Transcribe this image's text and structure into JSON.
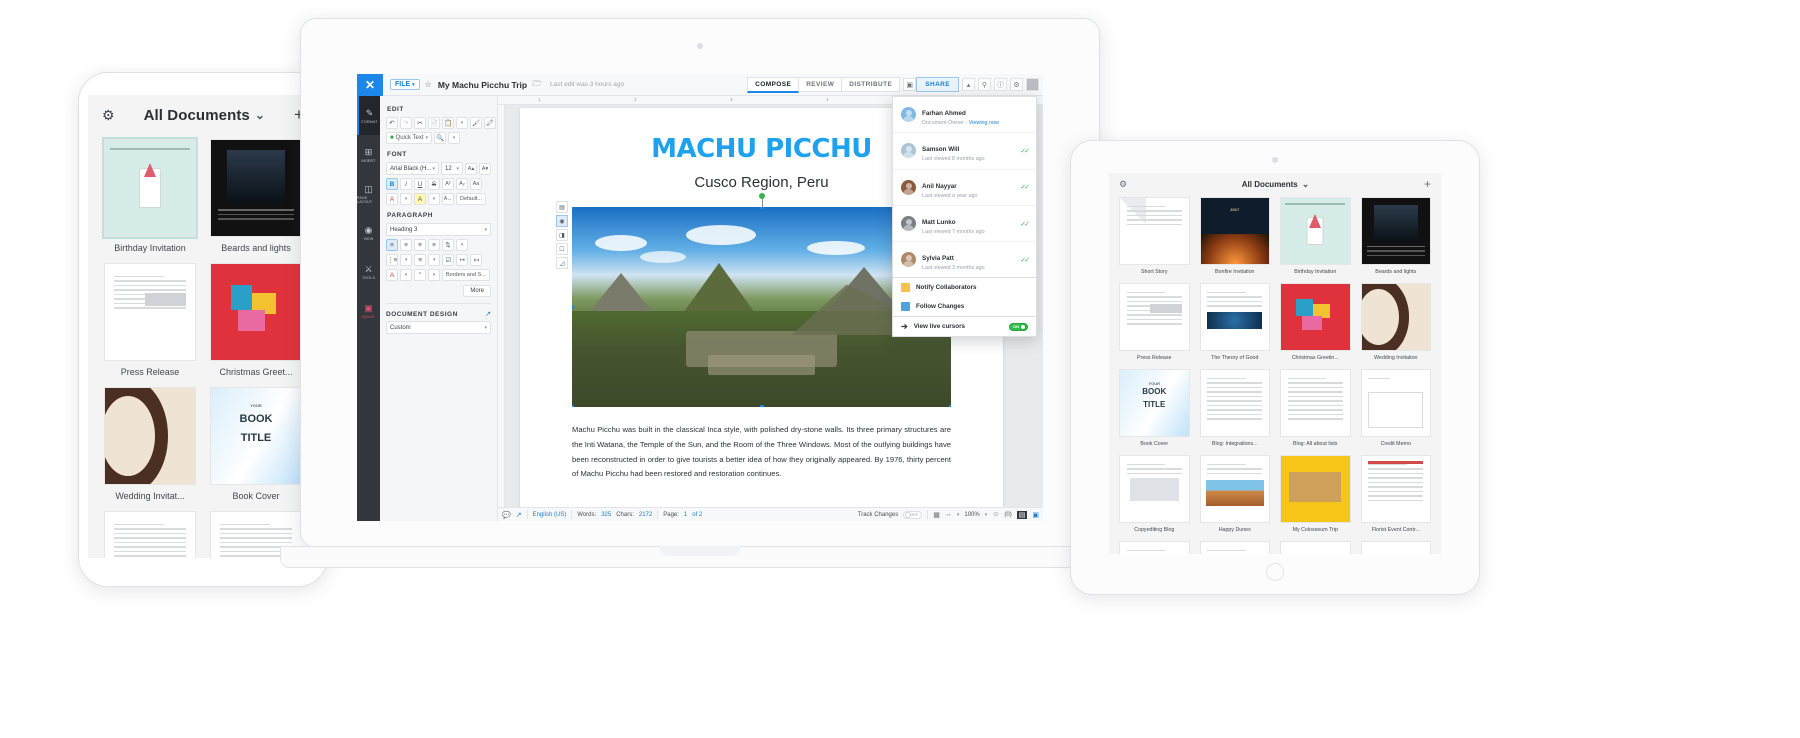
{
  "phone": {
    "header": {
      "title": "All Documents",
      "gear_icon": "gear-icon",
      "add_icon": "plus-icon",
      "chevron": "⌄"
    },
    "selected_actions": [
      "share-icon",
      "trash-icon",
      "info-icon"
    ],
    "documents": [
      {
        "label": "Birthday Invitation",
        "style": "birthday",
        "selected": true
      },
      {
        "label": "Beards and lights",
        "style": "beards"
      },
      {
        "label": "Press Release",
        "style": "press"
      },
      {
        "label": "Christmas Greet...",
        "style": "christmas"
      },
      {
        "label": "Wedding Invitat...",
        "style": "wedding"
      },
      {
        "label": "Book Cover",
        "style": "bookcover"
      },
      {
        "label": "",
        "style": "plain"
      },
      {
        "label": "",
        "style": "plain"
      }
    ]
  },
  "laptop": {
    "titlebar": {
      "close_label": "✕",
      "file_menu": "FILE",
      "star_icon": "star-icon",
      "doc_name": "My Machu Picchu Trip",
      "folder_icon": "folder-icon",
      "last_edit": "Last edit was 3 hours ago"
    },
    "tabs": [
      {
        "label": "COMPOSE",
        "active": true
      },
      {
        "label": "REVIEW",
        "active": false
      },
      {
        "label": "DISTRIBUTE",
        "active": false
      }
    ],
    "share_button": "SHARE",
    "top_icons": [
      "present-icon",
      "chevron-up-icon",
      "search-icon",
      "info-icon",
      "gear-icon",
      "avatar"
    ],
    "rail": [
      {
        "label": "FORMAT",
        "icon": "pencil-icon",
        "active": true
      },
      {
        "label": "INSERT",
        "icon": "insert-page-icon",
        "active": false
      },
      {
        "label": "PAGE LAYOUT",
        "icon": "page-layout-icon",
        "active": false
      },
      {
        "label": "VIEW",
        "icon": "eye-icon",
        "active": false
      },
      {
        "label": "TOOLS",
        "icon": "tools-icon",
        "active": false
      },
      {
        "label": "IMAGE",
        "icon": "image-icon",
        "active": false,
        "accent": "#e24a72"
      }
    ],
    "panel": {
      "edit_heading": "EDIT",
      "edit_buttons": [
        "undo-icon",
        "redo-icon",
        "cut-icon",
        "copy-icon",
        "paste-icon",
        "paste-caret",
        "format-painter-icon",
        "clear-format-icon"
      ],
      "quick_text": "Quick Text",
      "find_icon": "find-icon",
      "font_heading": "FONT",
      "font_family": "Arial Black (H...",
      "font_size": "12",
      "font_grow": "A↑",
      "font_shrink": "A↓",
      "style_buttons": [
        "B",
        "I",
        "U",
        "S",
        "x²",
        "A¹",
        "Aa"
      ],
      "color_buttons": [
        "font-color-icon",
        "highlight-icon",
        "char-spacing-icon"
      ],
      "default_button": "Default...",
      "paragraph_heading": "PARAGRAPH",
      "paragraph_style": "Heading 3",
      "align_buttons": [
        "align-left-icon",
        "align-center-icon",
        "align-right-icon",
        "align-justify-icon",
        "line-spacing-icon"
      ],
      "list_buttons": [
        "bullet-list-icon",
        "number-list-icon",
        "checklist-icon",
        "indent-icon",
        "outdent-icon"
      ],
      "shading_buttons": [
        "shading-icon",
        "quote-icon"
      ],
      "borders_button": "Borders and S...",
      "more_button": "More",
      "document_design_heading": "DOCUMENT DESIGN",
      "document_design_value": "Custom",
      "open_icon": "external-link-icon"
    },
    "ruler_ticks": [
      "1",
      "2",
      "3",
      "4",
      "5"
    ],
    "document": {
      "title": "MACHU PICCHU",
      "subtitle": "Cusco Region, Peru",
      "image_alt": "machu-picchu-photo",
      "body": "Machu Picchu was built in the classical Inca style, with polished dry-stone walls. Its three primary structures are the Inti Watana, the Temple of the Sun, and the Room of the Three Windows. Most of the outlying buildings have been reconstructed in order to give tourists a better idea of how they originally appeared. By 1976, thirty percent of Machu Picchu had been restored and restoration continues.",
      "image_toolbar": [
        "wrap-text-icon",
        "position-icon",
        "crop-icon",
        "replace-icon",
        "effects-icon"
      ]
    },
    "statusbar": {
      "comment_icon": "comment-icon",
      "share-doc_icon": "share-doc-icon",
      "language": "English (US)",
      "words_label": "Words:",
      "words_value": "325",
      "chars_label": "Chars:",
      "chars_value": "2172",
      "page_label": "Page:",
      "page_current": "1",
      "page_total": "of 2",
      "track_changes_label": "Track Changes",
      "track_changes_state": "OFF",
      "view_icons": [
        "reading-view-icon",
        "fit-width-icon"
      ],
      "zoom": "100%",
      "comments_count": "(0)",
      "layout_icons": [
        "page-view-icon",
        "screen-view-icon"
      ]
    },
    "collaborators": {
      "people": [
        {
          "name": "Farhan Ahmed",
          "sub": "Document Owner - ",
          "sub_now": "Viewing now",
          "owner": true,
          "avatar_color": "#7fb8e0"
        },
        {
          "name": "Samson Will",
          "sub": "Last viewed 8 months ago",
          "check": true,
          "avatar_color": "#a9c6d8"
        },
        {
          "name": "Anil Nayyar",
          "sub": "Last viewed a year ago",
          "check": true,
          "avatar_color": "#8c5a3c"
        },
        {
          "name": "Matt Lunko",
          "sub": "Last viewed 7 months ago",
          "check": true,
          "avatar_color": "#7b8086"
        },
        {
          "name": "Sylvia Patt",
          "sub": "Last viewed 3 months ago",
          "check": true,
          "avatar_color": "#b08968"
        }
      ],
      "actions": [
        {
          "label": "Notify Collaborators",
          "icon": "notify-icon",
          "color": "#f5c542"
        },
        {
          "label": "Follow Changes",
          "icon": "follow-icon",
          "color": "#4aa3e0"
        }
      ],
      "live_cursors": {
        "label": "View live cursors",
        "icon": "cursor-icon",
        "state": "ON"
      },
      "check_glyph": "✓✓"
    }
  },
  "tablet": {
    "header": {
      "title": "All Documents",
      "gear_icon": "gear-icon",
      "add_icon": "plus-icon",
      "chevron": "⌄"
    },
    "documents": [
      {
        "label": "Short Story",
        "style": "shortstory"
      },
      {
        "label": "Bonfire Invitation",
        "style": "bonfire"
      },
      {
        "label": "Birthday Invitation",
        "style": "birthday"
      },
      {
        "label": "Beards and lights",
        "style": "beards"
      },
      {
        "label": "Press Release",
        "style": "press"
      },
      {
        "label": "The Theory of Good",
        "style": "theory"
      },
      {
        "label": "Christmas Greetin...",
        "style": "christmas"
      },
      {
        "label": "Wedding Invitation",
        "style": "wedding"
      },
      {
        "label": "Book Cover",
        "style": "bookcover"
      },
      {
        "label": "Blog: Integrations...",
        "style": "doc"
      },
      {
        "label": "Blog: All about lists",
        "style": "doc"
      },
      {
        "label": "Credit Memo",
        "style": "memo"
      },
      {
        "label": "Copyediting Blog",
        "style": "copyedit"
      },
      {
        "label": "Happy Dunes",
        "style": "dunes"
      },
      {
        "label": "My Colosseum Trip",
        "style": "colosseum"
      },
      {
        "label": "Florist Event Contr...",
        "style": "florist"
      },
      {
        "label": "",
        "style": "doc2"
      },
      {
        "label": "",
        "style": "doc3"
      },
      {
        "label": "",
        "style": "machu"
      },
      {
        "label": "",
        "style": "circle"
      }
    ]
  },
  "colors": {
    "accent_blue": "#1c87e8",
    "link_blue": "#1a7fd4",
    "title_blue": "#1fa2ee",
    "green_on": "#2fc04c",
    "check_green": "#3cbb54",
    "rail_dark": "#33373c",
    "red_accent": "#e24a72"
  }
}
